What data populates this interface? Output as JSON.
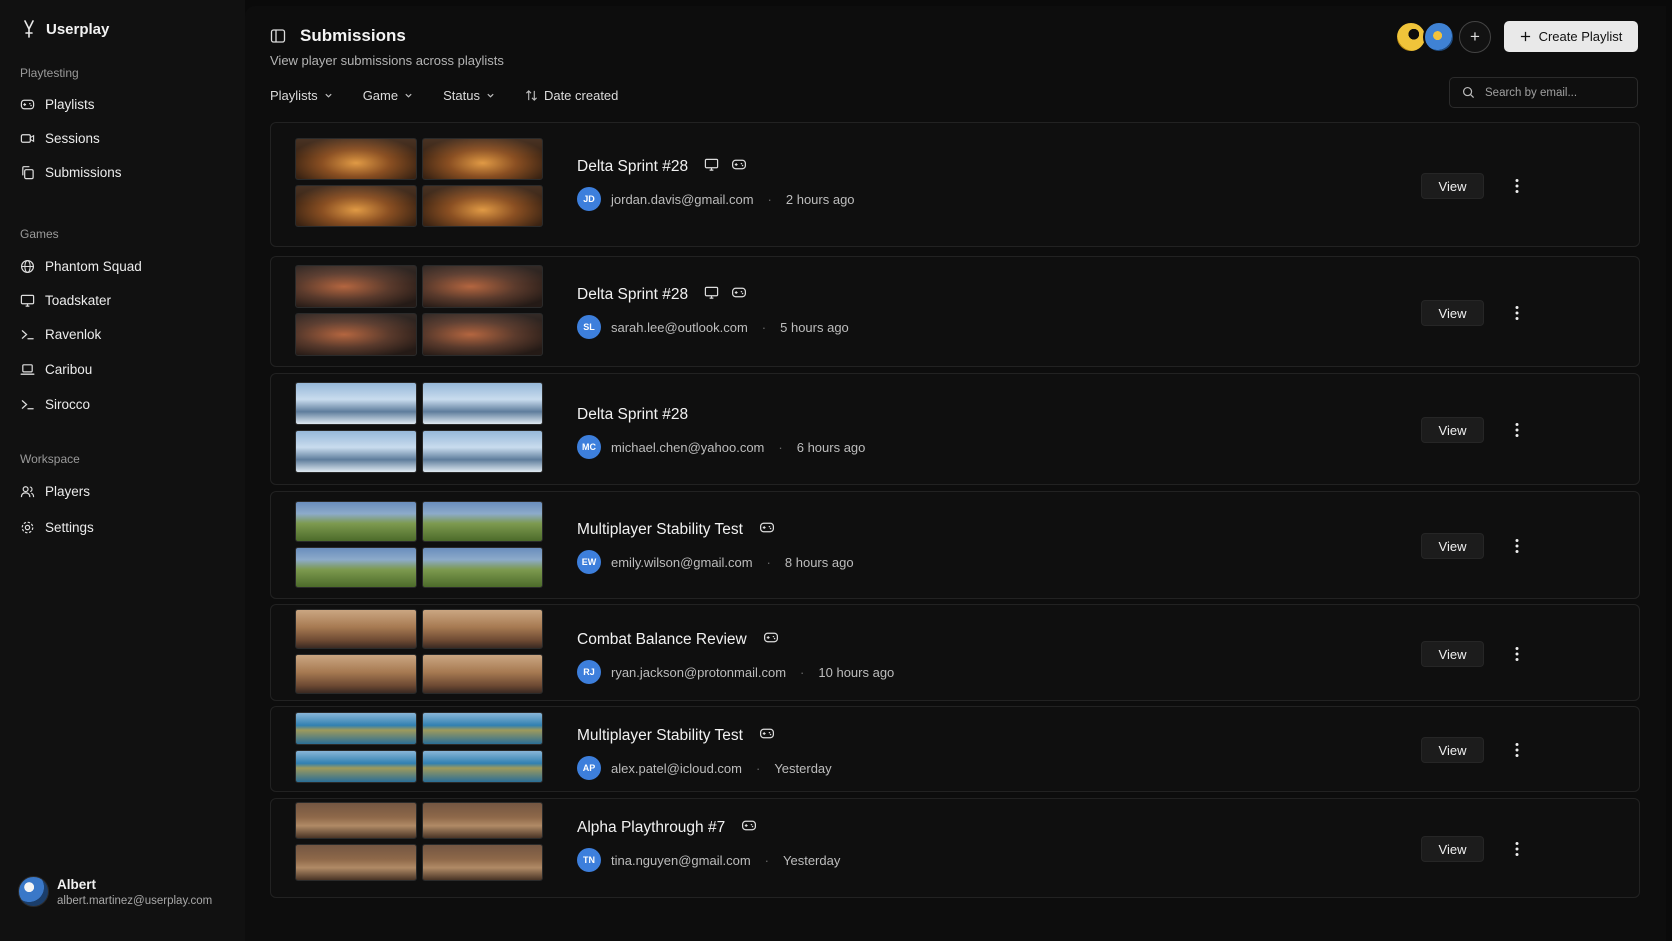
{
  "brand": {
    "name": "Userplay"
  },
  "sidebar": {
    "sections": [
      {
        "label": "Playtesting",
        "items": [
          {
            "label": "Playlists",
            "icon": "gamepad-icon"
          },
          {
            "label": "Sessions",
            "icon": "camera-icon"
          },
          {
            "label": "Submissions",
            "icon": "copy-icon"
          }
        ]
      },
      {
        "label": "Games",
        "items": [
          {
            "label": "Phantom Squad",
            "icon": "globe-icon"
          },
          {
            "label": "Toadskater",
            "icon": "monitor-icon"
          },
          {
            "label": "Ravenlok",
            "icon": "terminal-icon"
          },
          {
            "label": "Caribou",
            "icon": "laptop-icon"
          },
          {
            "label": "Sirocco",
            "icon": "terminal-icon"
          }
        ]
      },
      {
        "label": "Workspace",
        "items": [
          {
            "label": "Players",
            "icon": "users-icon"
          },
          {
            "label": "Settings",
            "icon": "gear-icon"
          }
        ]
      }
    ],
    "user": {
      "name": "Albert",
      "email": "albert.martinez@userplay.com"
    }
  },
  "header": {
    "title": "Submissions",
    "subtitle": "View player submissions across playlists",
    "create_label": "Create Playlist"
  },
  "filters": {
    "playlists": "Playlists",
    "game": "Game",
    "status": "Status",
    "date": "Date created"
  },
  "search": {
    "placeholder": "Search by email..."
  },
  "submissions": [
    {
      "title": "Delta Sprint #28",
      "icons": [
        "monitor-icon",
        "gamepad-icon"
      ],
      "initials": "JD",
      "email": "jordan.davis@gmail.com",
      "time": "2 hours ago",
      "view": "View",
      "thumb_style": "hall"
    },
    {
      "title": "Delta Sprint #28",
      "icons": [
        "monitor-icon",
        "gamepad-icon"
      ],
      "initials": "SL",
      "email": "sarah.lee@outlook.com",
      "time": "5 hours ago",
      "view": "View",
      "thumb_style": "ruin"
    },
    {
      "title": "Delta Sprint #28",
      "icons": [],
      "initials": "MC",
      "email": "michael.chen@yahoo.com",
      "time": "6 hours ago",
      "view": "View",
      "thumb_style": "snow"
    },
    {
      "title": "Multiplayer Stability Test",
      "icons": [
        "gamepad-icon"
      ],
      "initials": "EW",
      "email": "emily.wilson@gmail.com",
      "time": "8 hours ago",
      "view": "View",
      "thumb_style": "field"
    },
    {
      "title": "Combat Balance Review",
      "icons": [
        "gamepad-icon"
      ],
      "initials": "RJ",
      "email": "ryan.jackson@protonmail.com",
      "time": "10 hours ago",
      "view": "View",
      "thumb_style": "desert"
    },
    {
      "title": "Multiplayer Stability Test",
      "icons": [
        "gamepad-icon"
      ],
      "initials": "AP",
      "email": "alex.patel@icloud.com",
      "time": "Yesterday",
      "view": "View",
      "thumb_style": "sea"
    },
    {
      "title": "Alpha Playthrough #7",
      "icons": [
        "gamepad-icon"
      ],
      "initials": "TN",
      "email": "tina.nguyen@gmail.com",
      "time": "Yesterday",
      "view": "View",
      "thumb_style": "interior"
    }
  ]
}
